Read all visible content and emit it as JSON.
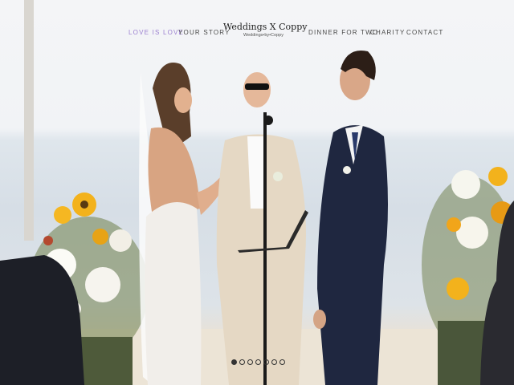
{
  "nav": {
    "left": [
      {
        "label": "LOVE IS LOVE",
        "active": true
      },
      {
        "label": "YOUR STORY",
        "active": false
      }
    ],
    "right": [
      {
        "label": "DINNER FOR TWO"
      },
      {
        "label": "CHARITY"
      },
      {
        "label": "CONTACT"
      }
    ],
    "accent_color": "#9b7fd0"
  },
  "logo": {
    "title": "Weddings X Coppy",
    "subtitle": "Weddings•by•Coppy"
  },
  "slider": {
    "total": 7,
    "active_index": 0
  }
}
